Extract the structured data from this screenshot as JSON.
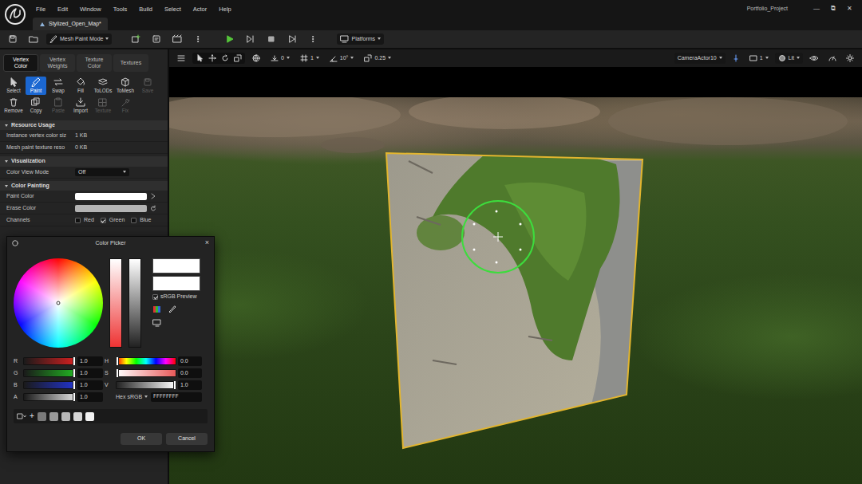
{
  "window": {
    "title": "Portfolio_Project",
    "controls": [
      "—",
      "⧉",
      "✕"
    ]
  },
  "menu": [
    "File",
    "Edit",
    "Window",
    "Tools",
    "Build",
    "Select",
    "Actor",
    "Help"
  ],
  "document_tab": {
    "label": "Stylized_Open_Map*",
    "selected": true
  },
  "toolbar": {
    "mode": "Mesh Paint Mode",
    "platforms": "Platforms"
  },
  "paint_panel": {
    "mode_tabs": [
      {
        "label": "Vertex Color",
        "selected": true
      },
      {
        "label": "Vertex Weights",
        "selected": false
      },
      {
        "label": "Texture Color",
        "selected": false
      },
      {
        "label": "Textures",
        "selected": false
      }
    ],
    "tools": [
      {
        "label": "Select",
        "selected": false,
        "disabled": false
      },
      {
        "label": "Paint",
        "selected": true,
        "disabled": false
      },
      {
        "label": "Swap",
        "selected": false,
        "disabled": false
      },
      {
        "label": "Fill",
        "selected": false,
        "disabled": false
      },
      {
        "label": "ToLODs",
        "selected": false,
        "disabled": false
      },
      {
        "label": "ToMesh",
        "selected": false,
        "disabled": false
      },
      {
        "label": "Save",
        "selected": false,
        "disabled": true
      },
      {
        "label": "Remove",
        "selected": false,
        "disabled": false
      },
      {
        "label": "Copy",
        "selected": false,
        "disabled": false
      },
      {
        "label": "Paste",
        "selected": false,
        "disabled": true
      },
      {
        "label": "Import",
        "selected": false,
        "disabled": false
      },
      {
        "label": "Texture",
        "selected": false,
        "disabled": true
      },
      {
        "label": "Fix",
        "selected": false,
        "disabled": true
      }
    ],
    "sections": [
      {
        "title": "Resource Usage",
        "expanded": true,
        "rows": [
          {
            "kind": "text",
            "label": "Instance vertex color siz",
            "value": "1 KB"
          },
          {
            "kind": "text",
            "label": "Mesh paint texture reso",
            "value": "0 KB"
          }
        ]
      },
      {
        "title": "Visualization",
        "expanded": true,
        "rows": [
          {
            "kind": "select",
            "label": "Color View Mode",
            "value": "Off"
          }
        ]
      },
      {
        "title": "Color Painting",
        "expanded": true,
        "rows": [
          {
            "kind": "color",
            "label": "Paint Color",
            "color": "#ffffff"
          },
          {
            "kind": "color",
            "label": "Erase Color",
            "color": "#b4b4b4"
          },
          {
            "kind": "channels",
            "label": "Channels",
            "channels": [
              {
                "label": "Red",
                "checked": false
              },
              {
                "label": "Green",
                "checked": true
              },
              {
                "label": "Blue",
                "checked": false
              }
            ]
          }
        ]
      }
    ]
  },
  "color_picker": {
    "title": "Color Picker",
    "close": "×",
    "preview": {
      "new": "#ffffff",
      "old": "#ffffff"
    },
    "srgb_preview": {
      "label": "sRGB Preview",
      "checked": true
    },
    "rgba": [
      {
        "label": "R",
        "value": "1.0",
        "level": 1,
        "color": "#d42020"
      },
      {
        "label": "G",
        "value": "1.0",
        "level": 1,
        "color": "#22b322"
      },
      {
        "label": "B",
        "value": "1.0",
        "level": 1,
        "color": "#2233cc"
      },
      {
        "label": "A",
        "value": "1.0",
        "level": 1,
        "color": "#dddddd"
      }
    ],
    "hsv": [
      {
        "label": "H",
        "value": "0.0",
        "level": 0,
        "kind": "hue"
      },
      {
        "label": "S",
        "value": "0.0",
        "level": 0,
        "kind": "saturation"
      },
      {
        "label": "V",
        "value": "1.0",
        "level": 1,
        "kind": "value"
      }
    ],
    "hex": {
      "label": "Hex sRGB",
      "value": "FFFFFFFF"
    },
    "palette_add": "+",
    "palette": [
      {
        "color": "#7a7a7a"
      },
      {
        "color": "#9a9a9a"
      },
      {
        "color": "#b8b8b8"
      },
      {
        "color": "#d6d6d6"
      },
      {
        "color": "#f2f2f2"
      }
    ],
    "buttons": [
      {
        "label": "OK"
      },
      {
        "label": "Cancel"
      }
    ]
  },
  "viewport": {
    "snaps": [
      "0",
      "1",
      "10°",
      "0.25"
    ],
    "camera": "CameraActor10",
    "layout": "1",
    "view_mode": "Lit"
  }
}
